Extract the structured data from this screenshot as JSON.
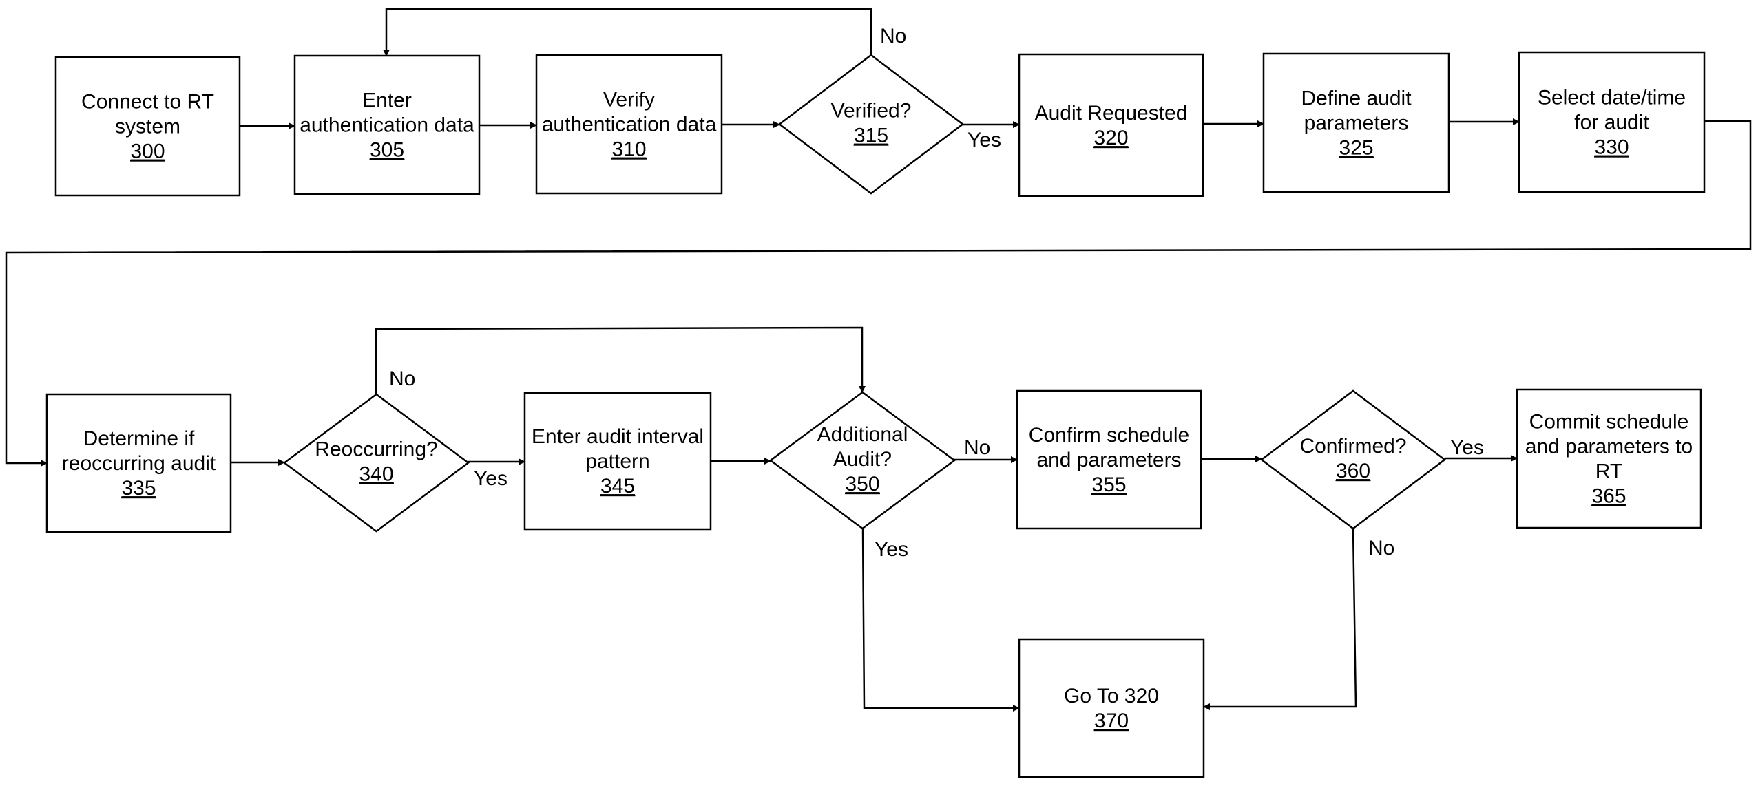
{
  "diagram": {
    "type": "flowchart",
    "nodes": [
      {
        "id": "300",
        "shape": "process",
        "lines": [
          "Connect to RT",
          "system"
        ],
        "ref": "300"
      },
      {
        "id": "305",
        "shape": "process",
        "lines": [
          "Enter",
          "authentication data"
        ],
        "ref": "305"
      },
      {
        "id": "310",
        "shape": "process",
        "lines": [
          "Verify",
          "authentication data"
        ],
        "ref": "310"
      },
      {
        "id": "315",
        "shape": "decision",
        "lines": [
          "Verified?"
        ],
        "ref": "315"
      },
      {
        "id": "320",
        "shape": "process",
        "lines": [
          "Audit Requested"
        ],
        "ref": "320"
      },
      {
        "id": "325",
        "shape": "process",
        "lines": [
          "Define audit",
          "parameters"
        ],
        "ref": "325"
      },
      {
        "id": "330",
        "shape": "process",
        "lines": [
          "Select date/time",
          "for audit"
        ],
        "ref": "330"
      },
      {
        "id": "335",
        "shape": "process",
        "lines": [
          "Determine if",
          "reoccurring audit"
        ],
        "ref": "335"
      },
      {
        "id": "340",
        "shape": "decision",
        "lines": [
          "Reoccurring?"
        ],
        "ref": "340"
      },
      {
        "id": "345",
        "shape": "process",
        "lines": [
          "Enter audit interval",
          "pattern"
        ],
        "ref": "345"
      },
      {
        "id": "350",
        "shape": "decision",
        "lines": [
          "Additional",
          "Audit?"
        ],
        "ref": "350"
      },
      {
        "id": "355",
        "shape": "process",
        "lines": [
          "Confirm schedule",
          "and parameters"
        ],
        "ref": "355"
      },
      {
        "id": "360",
        "shape": "decision",
        "lines": [
          "Confirmed?"
        ],
        "ref": "360"
      },
      {
        "id": "365",
        "shape": "process",
        "lines": [
          "Commit schedule",
          "and parameters to",
          "RT"
        ],
        "ref": "365"
      },
      {
        "id": "370",
        "shape": "process",
        "lines": [
          "Go To 320"
        ],
        "ref": "370"
      }
    ],
    "edges": [
      {
        "from": "300",
        "to": "305",
        "label": ""
      },
      {
        "from": "305",
        "to": "310",
        "label": ""
      },
      {
        "from": "310",
        "to": "315",
        "label": ""
      },
      {
        "from": "315",
        "to": "320",
        "label": "Yes"
      },
      {
        "from": "315",
        "to": "305",
        "label": "No"
      },
      {
        "from": "320",
        "to": "325",
        "label": ""
      },
      {
        "from": "325",
        "to": "330",
        "label": ""
      },
      {
        "from": "330",
        "to": "335",
        "label": ""
      },
      {
        "from": "335",
        "to": "340",
        "label": ""
      },
      {
        "from": "340",
        "to": "345",
        "label": "Yes"
      },
      {
        "from": "340",
        "to": "350",
        "label": "No"
      },
      {
        "from": "345",
        "to": "350",
        "label": ""
      },
      {
        "from": "350",
        "to": "355",
        "label": "No"
      },
      {
        "from": "350",
        "to": "370",
        "label": "Yes"
      },
      {
        "from": "355",
        "to": "360",
        "label": ""
      },
      {
        "from": "360",
        "to": "365",
        "label": "Yes"
      },
      {
        "from": "360",
        "to": "370",
        "label": "No"
      }
    ]
  },
  "colors": {
    "stroke": "#000000",
    "background": "#ffffff"
  }
}
